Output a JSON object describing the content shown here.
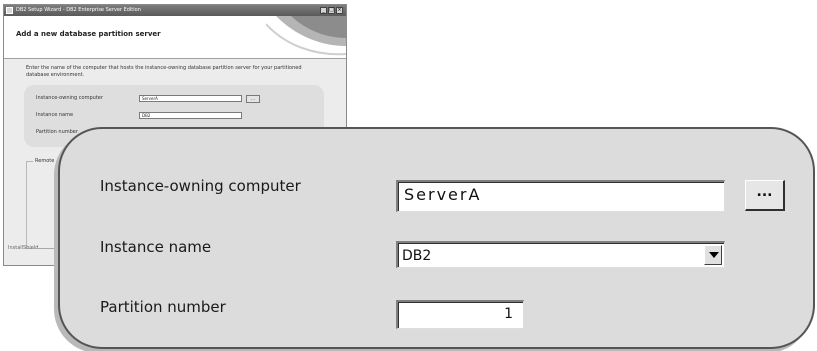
{
  "thumbnail": {
    "window_title": "DB2 Setup Wizard - DB2 Enterprise Server Edition",
    "page_heading": "Add a new database partition server",
    "description": "Enter the name of the computer that hosts the instance-owning database partition server for your partitioned database environment.",
    "fields": {
      "instance_owning_label": "Instance-owning computer",
      "instance_owning_value": "ServerA",
      "browse_label": "...",
      "instance_name_label": "Instance name",
      "instance_name_value": "DB2",
      "partition_number_label": "Partition number",
      "partition_number_value": "1"
    },
    "group_label": "Remote",
    "footer_brand": "InstallShield"
  },
  "callout": {
    "instance_owning_label": "Instance-owning computer",
    "instance_owning_value": "ServerA",
    "browse_label": "...",
    "instance_name_label": "Instance name",
    "instance_name_value": "DB2",
    "partition_number_label": "Partition number",
    "partition_number_value": "1"
  }
}
